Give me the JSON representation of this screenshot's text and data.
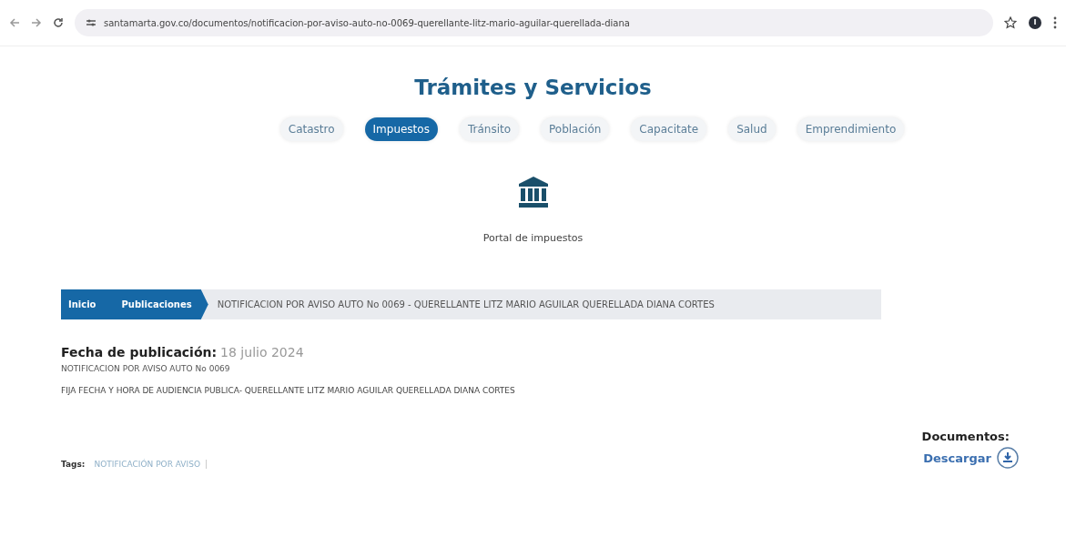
{
  "browser": {
    "url": "santamarta.gov.co/documentos/notificacion-por-aviso-auto-no-0069-querellante-litz-mario-aguilar-querellada-diana"
  },
  "header": {
    "title": "Trámites y Servicios"
  },
  "tabs": [
    {
      "label": "Catastro",
      "selected": false
    },
    {
      "label": "Impuestos",
      "selected": true
    },
    {
      "label": "Tránsito",
      "selected": false
    },
    {
      "label": "Población",
      "selected": false
    },
    {
      "label": "Capacitate",
      "selected": false
    },
    {
      "label": "Salud",
      "selected": false
    },
    {
      "label": "Emprendimiento",
      "selected": false
    }
  ],
  "portal": {
    "label": "Portal de impuestos"
  },
  "breadcrumb": {
    "links": [
      "Inicio",
      "Publicaciones"
    ],
    "current": "NOTIFICACION POR AVISO AUTO No 0069 - QUERELLANTE LITZ MARIO AGUILAR QUERELLADA DIANA CORTES"
  },
  "publication": {
    "date_label": "Fecha de publicación:",
    "date": "18 julio 2024",
    "subtitle": "NOTIFICACION POR AVISO AUTO No 0069",
    "description": "FIJA FECHA Y HORA DE AUDIENCIA PUBLICA- QUERELLANTE LITZ MARIO AGUILAR QUERELLADA DIANA CORTES"
  },
  "documents": {
    "label": "Documentos:",
    "download": "Descargar"
  },
  "tags": {
    "label": "Tags:",
    "items": [
      "NOTIFICACIÓN POR AVISO"
    ]
  }
}
